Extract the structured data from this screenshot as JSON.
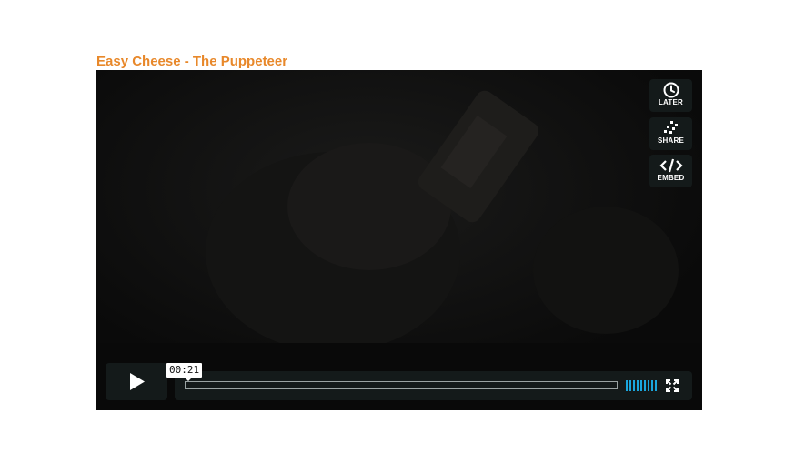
{
  "video": {
    "title": "Easy Cheese - The Puppeteer",
    "title_color": "#e8882a"
  },
  "side_buttons": {
    "later": {
      "label": "LATER",
      "icon": "clock-icon"
    },
    "share": {
      "label": "SHARE",
      "icon": "share-icon"
    },
    "embed": {
      "label": "EMBED",
      "icon": "code-icon"
    }
  },
  "controls": {
    "play_icon": "play-icon",
    "time_tooltip": "00:21",
    "volume_icon": "volume-bars-icon",
    "volume_color": "#1aa6dd",
    "fullscreen_icon": "fullscreen-icon",
    "progress_fraction": 0.0
  }
}
